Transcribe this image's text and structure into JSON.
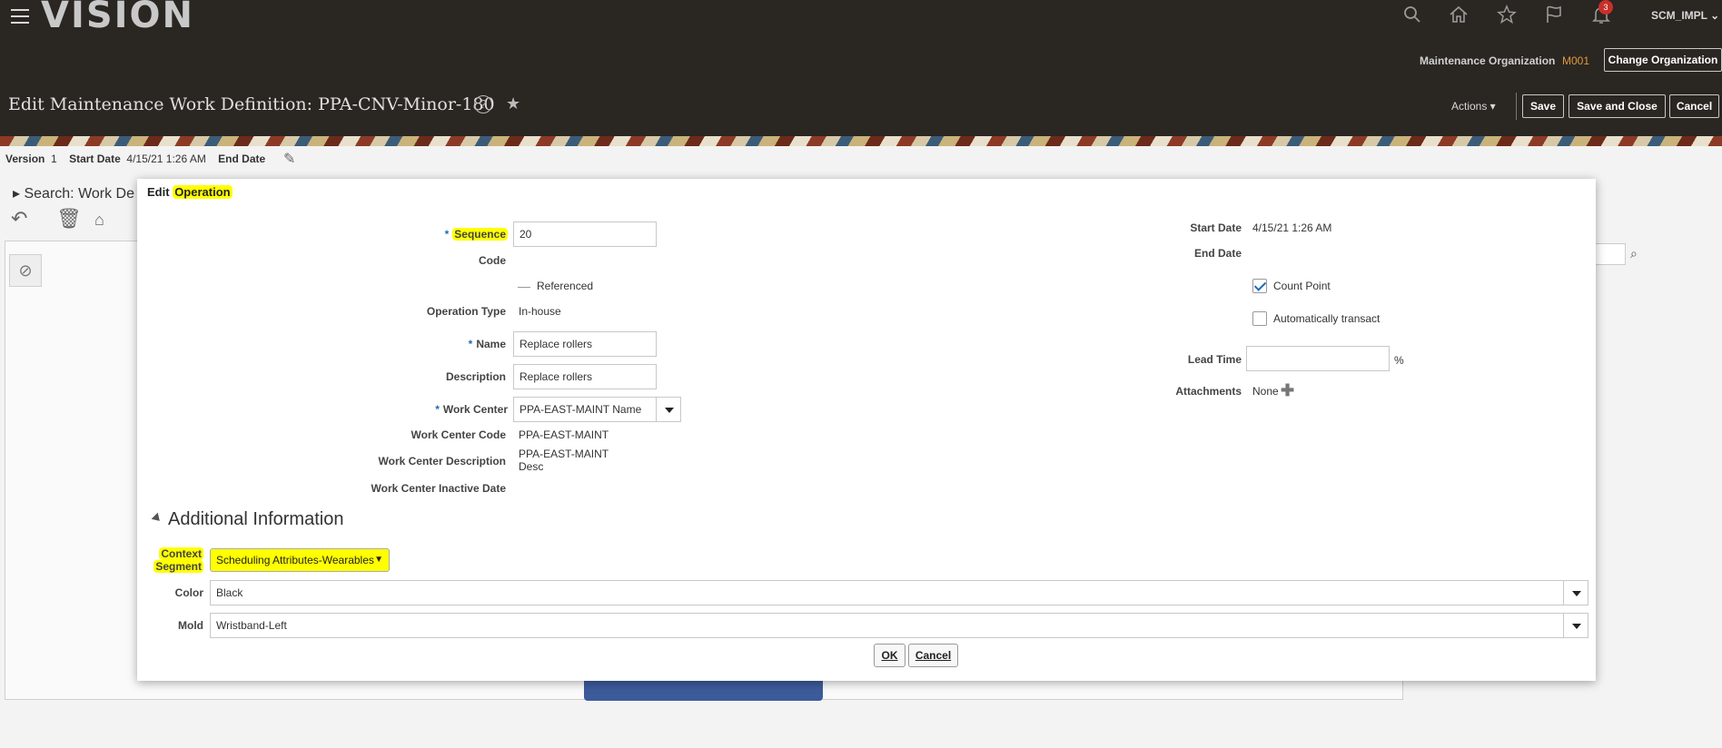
{
  "header": {
    "logo": "VISION",
    "user": "SCM_IMPL",
    "notification_count": "3",
    "org_label": "Maintenance Organization",
    "org_value": "M001",
    "change_org_label": "Change Organization",
    "page_title": "Edit Maintenance Work Definition: PPA-CNV-Minor-180",
    "help_symbol": "?",
    "fav_symbol": "★",
    "actions_label": "Actions ▾",
    "save_label": "Save",
    "save_close_label": "Save and Close",
    "cancel_label": "Cancel",
    "icons": [
      "menu-icon",
      "search-icon",
      "home-icon",
      "star-icon",
      "flag-icon",
      "bell-icon"
    ]
  },
  "background": {
    "version_label": "Version",
    "version_value": "1",
    "start_date_label": "Start Date",
    "start_date_value": "4/15/21 1:26 AM",
    "end_date_label": "End Date",
    "search_label": "Search: Work De"
  },
  "dialog": {
    "title_prefix": "Edit",
    "title_highlight": "Operation",
    "left": {
      "sequence_label": "Sequence",
      "sequence_value": "20",
      "code_label": "Code",
      "referenced_label": "Referenced",
      "operation_type_label": "Operation Type",
      "operation_type_value": "In-house",
      "name_label": "Name",
      "name_value": "Replace rollers",
      "description_label": "Description",
      "description_value": "Replace rollers",
      "work_center_label": "Work Center",
      "work_center_value": "PPA-EAST-MAINT Name",
      "work_center_code_label": "Work Center Code",
      "work_center_code_value": "PPA-EAST-MAINT",
      "work_center_desc_label": "Work Center Description",
      "work_center_desc_value_1": "PPA-EAST-MAINT",
      "work_center_desc_value_2": "Desc",
      "work_center_inactive_label": "Work Center Inactive Date"
    },
    "right": {
      "start_date_label": "Start Date",
      "start_date_value": "4/15/21 1:26 AM",
      "end_date_label": "End Date",
      "count_point_label": "Count Point",
      "count_point_checked": true,
      "auto_transact_label": "Automatically transact",
      "auto_transact_checked": false,
      "lead_time_label": "Lead Time",
      "lead_time_unit": "%",
      "attachments_label": "Attachments",
      "attachments_value": "None"
    },
    "additional": {
      "section_title": "Additional Information",
      "context_label_1": "Context",
      "context_label_2": "Segment",
      "context_value": "Scheduling Attributes-Wearables",
      "color_label": "Color",
      "color_value": "Black",
      "mold_label": "Mold",
      "mold_value": "Wristband-Left"
    },
    "ok_label": "OK",
    "cancel_label": "Cancel"
  }
}
